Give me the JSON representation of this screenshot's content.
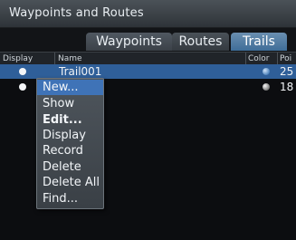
{
  "window": {
    "title": "Waypoints and Routes"
  },
  "tabs": [
    {
      "label": "Waypoints",
      "active": false
    },
    {
      "label": "Routes",
      "active": false
    },
    {
      "label": "Trails",
      "active": true
    }
  ],
  "table": {
    "columns": {
      "display": "Display",
      "name": "Name",
      "color": "Color",
      "points": "Poi"
    },
    "rows": [
      {
        "name": "Trail001",
        "points": "25",
        "selected": true
      },
      {
        "name": "",
        "points": "18",
        "selected": false
      }
    ]
  },
  "menu": {
    "items": [
      {
        "label": "New...",
        "selected": true
      },
      {
        "label": "Show"
      },
      {
        "label": "Edit...",
        "bold": true
      },
      {
        "label": "Display"
      },
      {
        "label": "Record"
      },
      {
        "label": "Delete"
      },
      {
        "label": "Delete All"
      },
      {
        "label": "Find..."
      }
    ]
  },
  "colors": {
    "selection": "#2f5f99",
    "active_tab": "#3f6d98",
    "menu_highlight": "#3f73b7"
  }
}
